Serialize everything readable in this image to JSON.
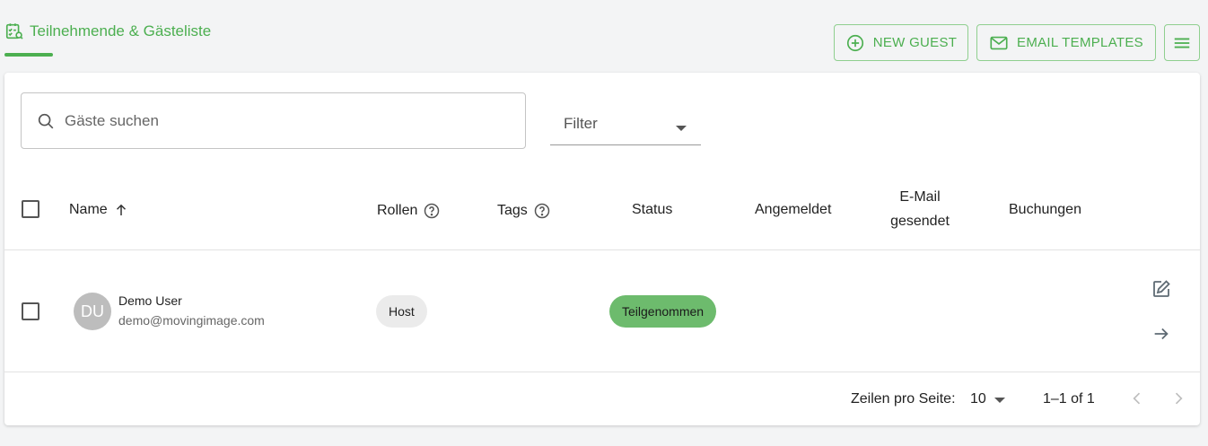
{
  "header": {
    "tab_label": "Teilnehmende & Gästeliste",
    "new_guest_label": "NEW GUEST",
    "email_templates_label": "EMAIL TEMPLATES"
  },
  "toolbar": {
    "search_placeholder": "Gäste suchen",
    "filter_label": "Filter"
  },
  "table": {
    "columns": {
      "name": "Name",
      "rollen": "Rollen",
      "tags": "Tags",
      "status": "Status",
      "angemeldet": "Angemeldet",
      "email_line1": "E-Mail",
      "email_line2": "gesendet",
      "buchungen": "Buchungen"
    },
    "sort": "Name ascending",
    "rows": [
      {
        "initials": "DU",
        "name": "Demo User",
        "email": "demo@movingimage.com",
        "role": "Host",
        "status": "Teilgenommen"
      }
    ]
  },
  "pagination": {
    "rows_per_page_label": "Zeilen pro Seite:",
    "rows_per_page_value": "10",
    "range_label": "1–1 of 1"
  },
  "colors": {
    "accent": "#4caf50",
    "status_chip": "#6dbb6d",
    "role_chip": "#ebebeb",
    "avatar": "#bdbdbd"
  }
}
